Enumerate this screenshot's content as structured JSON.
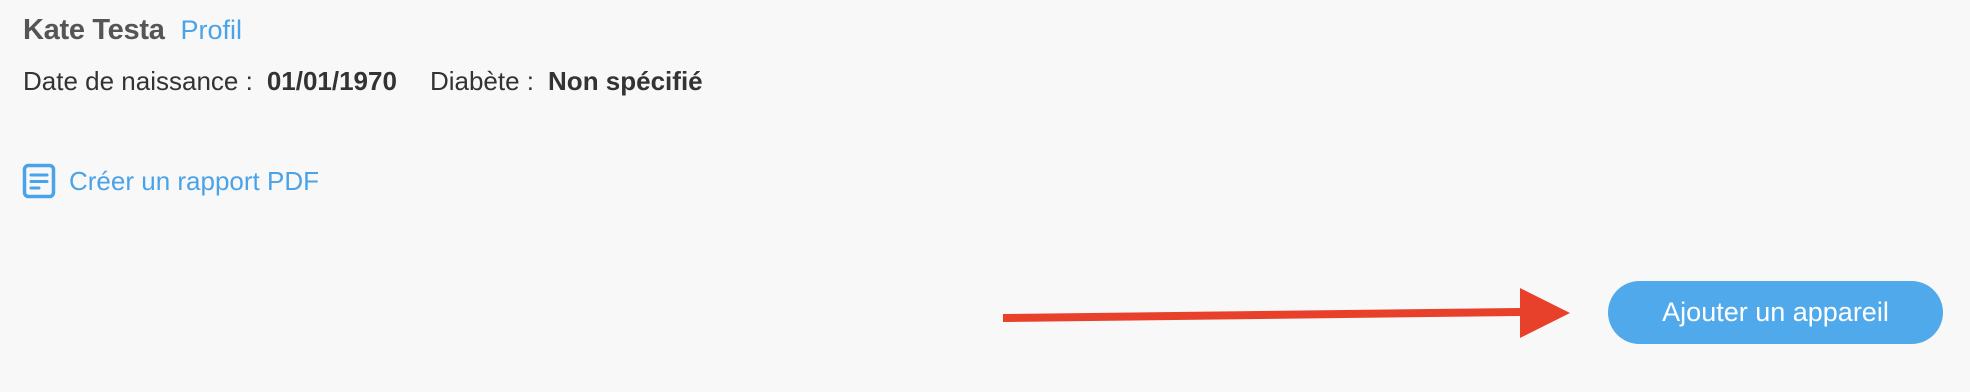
{
  "patient": {
    "name": "Kate Testa",
    "profile_link": "Profil"
  },
  "info": {
    "birthdate_label": "Date de naissance :",
    "birthdate_value": "01/01/1970",
    "diabetes_label": "Diabète :",
    "diabetes_value": "Non spécifié"
  },
  "actions": {
    "pdf_report_label": "Créer un rapport PDF",
    "pdf_icon": "document-icon",
    "add_device_label": "Ajouter un appareil"
  },
  "colors": {
    "background": "#f8f8f8",
    "accent": "#4aa3e8",
    "button": "#4fa9ea",
    "annotation_arrow": "#e8412b"
  }
}
